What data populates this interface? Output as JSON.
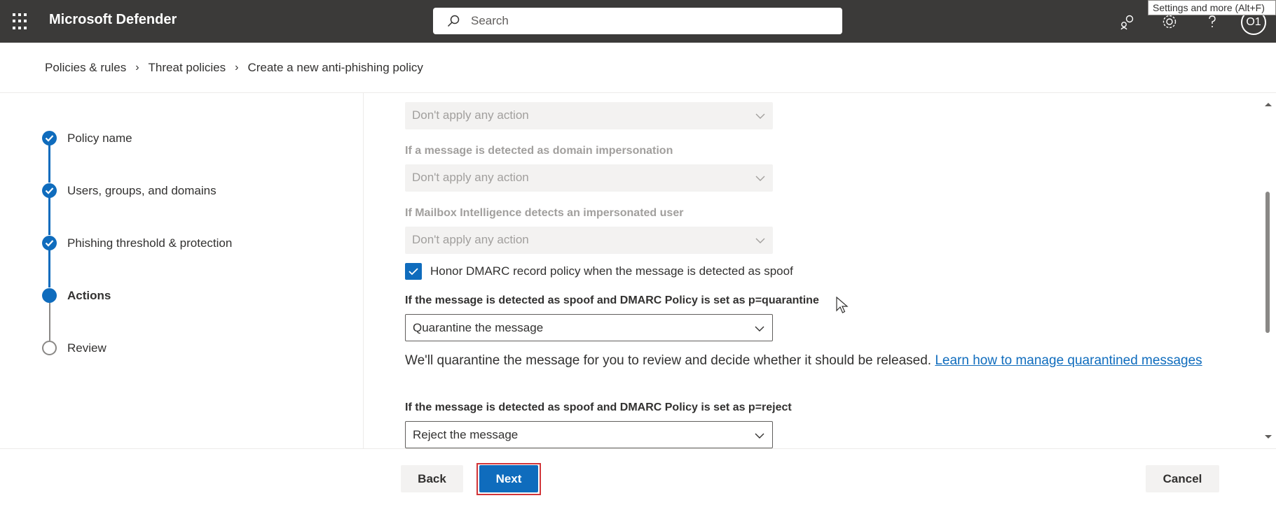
{
  "app": {
    "title": "Microsoft Defender"
  },
  "search": {
    "placeholder": "Search"
  },
  "header_icons": [
    "community-icon",
    "settings-icon",
    "help-icon"
  ],
  "tooltip": "Settings and more (Alt+F)",
  "avatar": {
    "initials": "O1"
  },
  "breadcrumb": [
    "Policies & rules",
    "Threat policies",
    "Create a new anti-phishing policy"
  ],
  "steps": [
    {
      "label": "Policy name",
      "status": "complete"
    },
    {
      "label": "Users, groups, and domains",
      "status": "complete"
    },
    {
      "label": "Phishing threshold & protection",
      "status": "complete"
    },
    {
      "label": "Actions",
      "status": "current"
    },
    {
      "label": "Review",
      "status": "pending"
    }
  ],
  "actions": {
    "field1": {
      "value": "Don't apply any action",
      "disabled": true
    },
    "field2": {
      "label": "If a message is detected as domain impersonation",
      "value": "Don't apply any action",
      "disabled": true
    },
    "field3": {
      "label": "If Mailbox Intelligence detects an impersonated user",
      "value": "Don't apply any action",
      "disabled": true
    },
    "honor_dmarc": {
      "label": "Honor DMARC record policy when the message is detected as spoof",
      "checked": true
    },
    "quarantine": {
      "label": "If the message is detected as spoof and DMARC Policy is set as p=quarantine",
      "value": "Quarantine the message"
    },
    "quarantine_desc": {
      "text": "We'll quarantine the message for you to review and decide whether it should be released.",
      "link": "Learn how to manage quarantined messages"
    },
    "reject": {
      "label": "If the message is detected as spoof and DMARC Policy is set as p=reject",
      "value": "Reject the message"
    }
  },
  "footer": {
    "back": "Back",
    "next": "Next",
    "cancel": "Cancel"
  },
  "colors": {
    "accent": "#0f6cbd",
    "topbar": "#3b3a39",
    "highlight": "#d13438"
  }
}
